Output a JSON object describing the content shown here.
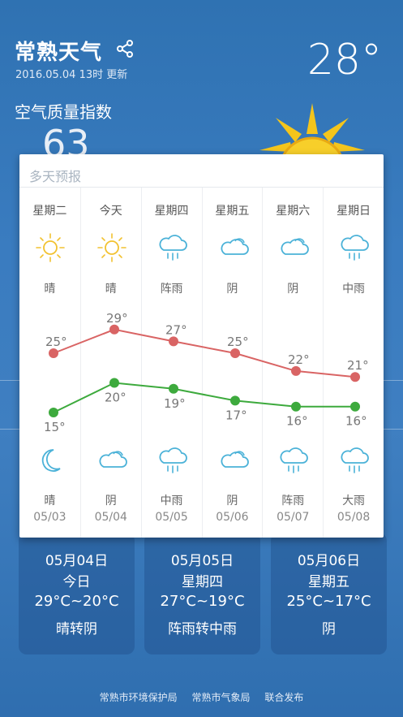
{
  "header": {
    "city": "常熟天气",
    "updated": "2016.05.04 13时 更新",
    "current_temp": "28°"
  },
  "aqi": {
    "title": "空气质量指数",
    "value": "63"
  },
  "panel": {
    "title": "多天预报",
    "days": [
      {
        "weekday": "星期二",
        "day_icon": "sun-icon",
        "day_weather": "晴",
        "high": 25,
        "high_label": "25°",
        "low": 15,
        "low_label": "15°",
        "night_icon": "moon-icon",
        "night_weather": "晴",
        "date": "05/03"
      },
      {
        "weekday": "今天",
        "day_icon": "sun-icon",
        "day_weather": "晴",
        "high": 29,
        "high_label": "29°",
        "low": 20,
        "low_label": "20°",
        "night_icon": "cloud-icon",
        "night_weather": "阴",
        "date": "05/04"
      },
      {
        "weekday": "星期四",
        "day_icon": "rain-cloud-icon",
        "day_weather": "阵雨",
        "high": 27,
        "high_label": "27°",
        "low": 19,
        "low_label": "19°",
        "night_icon": "rain-cloud-icon",
        "night_weather": "中雨",
        "date": "05/05"
      },
      {
        "weekday": "星期五",
        "day_icon": "cloud-icon",
        "day_weather": "阴",
        "high": 25,
        "high_label": "25°",
        "low": 17,
        "low_label": "17°",
        "night_icon": "cloud-icon",
        "night_weather": "阴",
        "date": "05/06"
      },
      {
        "weekday": "星期六",
        "day_icon": "cloud-icon",
        "day_weather": "阴",
        "high": 22,
        "high_label": "22°",
        "low": 16,
        "low_label": "16°",
        "night_icon": "rain-cloud-icon",
        "night_weather": "阵雨",
        "date": "05/07"
      },
      {
        "weekday": "星期日",
        "day_icon": "rain-cloud-icon",
        "day_weather": "中雨",
        "high": 21,
        "high_label": "21°",
        "low": 16,
        "low_label": "16°",
        "night_icon": "rain-cloud-icon",
        "night_weather": "大雨",
        "date": "05/08"
      }
    ],
    "high_color": "#d96464",
    "low_color": "#3daa3d"
  },
  "cards": [
    {
      "date": "05月04日",
      "weekday": "今日",
      "temp": "29°C~20°C",
      "cond": "晴转阴"
    },
    {
      "date": "05月05日",
      "weekday": "星期四",
      "temp": "27°C~19°C",
      "cond": "阵雨转中雨"
    },
    {
      "date": "05月06日",
      "weekday": "星期五",
      "temp": "25°C~17°C",
      "cond": "阴"
    }
  ],
  "footer": {
    "org1": "常熟市环境保护局",
    "org2": "常熟市气象局",
    "org3": "联合发布"
  }
}
